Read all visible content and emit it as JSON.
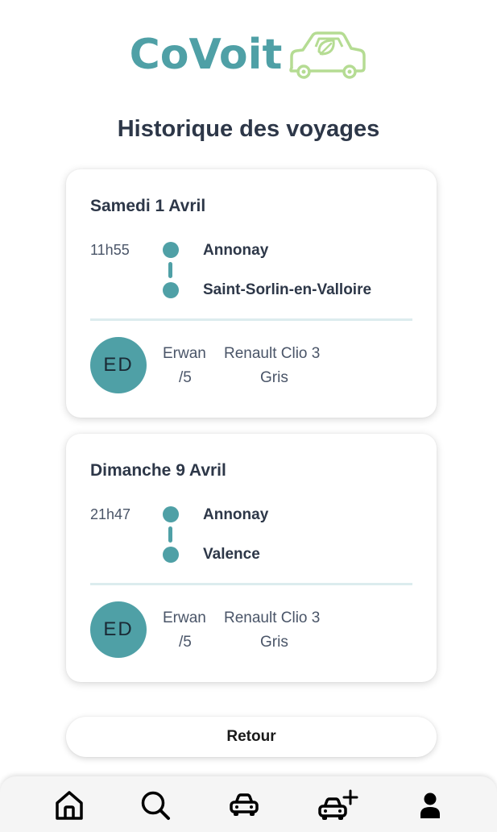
{
  "app": {
    "logo_text": "CoVoit",
    "logo_color": "#4fa0a6",
    "logo_icon": "eco-car-icon",
    "logo_icon_color": "#b5dc93"
  },
  "page": {
    "title": "Historique des voyages"
  },
  "trips": [
    {
      "date": "Samedi 1 Avril",
      "time": "11h55",
      "from": "Annonay",
      "to": "Saint-Sorlin-en-Valloire",
      "driver": {
        "initials": "ED",
        "name": "Erwan",
        "rating": "/5"
      },
      "car": {
        "model": "Renault Clio 3",
        "color": "Gris"
      }
    },
    {
      "date": "Dimanche 9 Avril",
      "time": "21h47",
      "from": "Annonay",
      "to": "Valence",
      "driver": {
        "initials": "ED",
        "name": "Erwan",
        "rating": "/5"
      },
      "car": {
        "model": "Renault Clio 3",
        "color": "Gris"
      }
    }
  ],
  "actions": {
    "back_label": "Retour"
  },
  "nav": {
    "items": [
      {
        "icon": "home-icon"
      },
      {
        "icon": "search-icon"
      },
      {
        "icon": "car-icon"
      },
      {
        "icon": "add-car-icon"
      },
      {
        "icon": "user-icon"
      }
    ]
  },
  "colors": {
    "accent": "#4fa0a6",
    "text": "#2d3748",
    "divider": "#dcecee",
    "nav_background": "#f5f5f5"
  }
}
